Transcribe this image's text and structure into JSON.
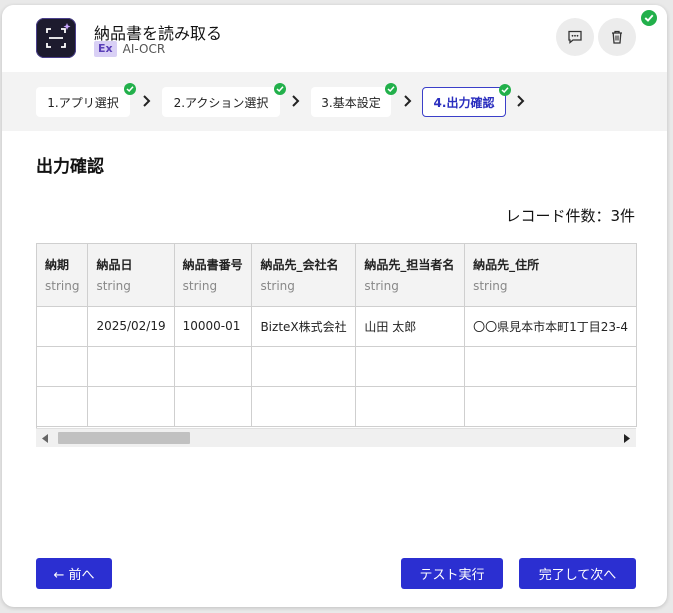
{
  "header": {
    "title": "納品書を読み取る",
    "badge": "Ex",
    "subtitle": "AI-OCR"
  },
  "steps": [
    {
      "label": "1.アプリ選択",
      "completed": true,
      "active": false
    },
    {
      "label": "2.アクション選択",
      "completed": true,
      "active": false
    },
    {
      "label": "3.基本設定",
      "completed": true,
      "active": false
    },
    {
      "label": "4.出力確認",
      "completed": true,
      "active": true
    }
  ],
  "section_title": "出力確認",
  "record_count": "レコード件数：3件",
  "table": {
    "columns": [
      {
        "name": "納期",
        "type": "string"
      },
      {
        "name": "納品日",
        "type": "string"
      },
      {
        "name": "納品書番号",
        "type": "string"
      },
      {
        "name": "納品先_会社名",
        "type": "string"
      },
      {
        "name": "納品先_担当者名",
        "type": "string"
      },
      {
        "name": "納品先_住所",
        "type": "string"
      }
    ],
    "rows": [
      [
        "",
        "2025/02/19",
        "10000-01",
        "BizteX株式会社",
        "山田 太郎",
        "〇〇県見本市本町1丁目23-4"
      ],
      [
        "",
        "",
        "",
        "",
        "",
        ""
      ],
      [
        "",
        "",
        "",
        "",
        "",
        ""
      ]
    ]
  },
  "buttons": {
    "prev": "← 前へ",
    "test": "テスト実行",
    "next": "完了して次へ"
  },
  "colors": {
    "primary": "#2b2fd1",
    "success": "#22b04b",
    "badge_bg": "#d9d0f5"
  }
}
